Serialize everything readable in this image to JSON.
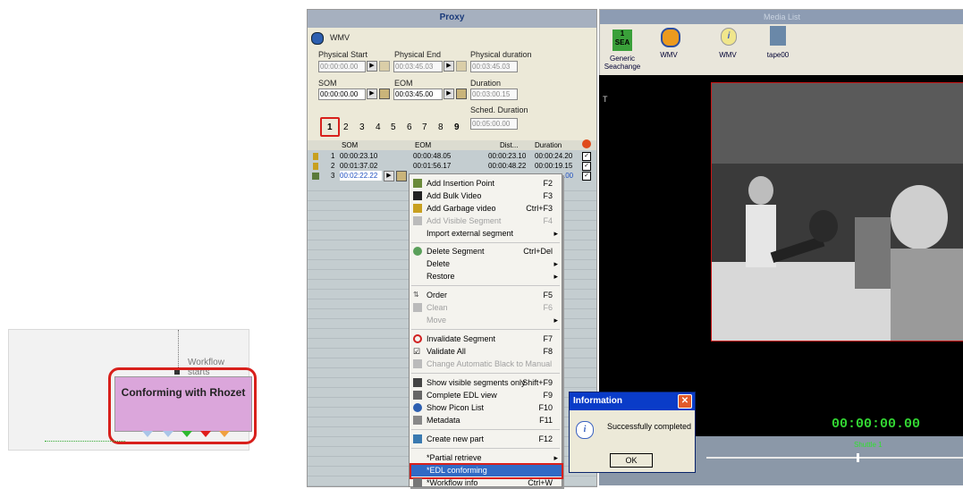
{
  "workflow": {
    "start_label": "Workflow starts",
    "node_label": "Conforming with Rhozet"
  },
  "proxy": {
    "title": "Proxy",
    "media_label": "WMV",
    "physical_start_label": "Physical Start",
    "physical_start_value": "00:00:00.00",
    "physical_end_label": "Physical End",
    "physical_end_value": "00:03:45.03",
    "physical_duration_label": "Physical duration",
    "physical_duration_value": "00:03:45.03",
    "som_label": "SOM",
    "som_value": "00:00:00.00",
    "eom_label": "EOM",
    "eom_value": "00:03:45.00",
    "duration_label": "Duration",
    "duration_value": "00:03:00.15",
    "sched_duration_label": "Sched. Duration",
    "sched_duration_value": "00:05:00.00",
    "parts": [
      "1",
      "2",
      "3",
      "4",
      "5",
      "6",
      "7",
      "8",
      "9"
    ]
  },
  "segments": {
    "columns": [
      "SOM",
      "EOM",
      "Dist...",
      "Duration"
    ],
    "rows": [
      {
        "num": "1",
        "som": "00:00:23.10",
        "eom": "00:00:48.05",
        "dist": "00:00:23.10",
        "duration": "00:00:24.20"
      },
      {
        "num": "2",
        "som": "00:01:37.02",
        "eom": "00:01:56.17",
        "dist": "00:00:48.22",
        "duration": "00:00:19.15"
      },
      {
        "num": "3",
        "som": "00:02:22.22",
        "eom": "",
        "dist": "",
        "duration": ".00"
      }
    ]
  },
  "context_menu": {
    "items": [
      {
        "label": "Add Insertion Point",
        "key": "F2"
      },
      {
        "label": "Add Bulk Video",
        "key": "F3"
      },
      {
        "label": "Add Garbage video",
        "key": "Ctrl+F3"
      },
      {
        "label": "Add Visible Segment",
        "key": "F4"
      },
      {
        "label": "Import external segment",
        "key": ""
      },
      {
        "label": "Delete Segment",
        "key": "Ctrl+Del"
      },
      {
        "label": "Delete",
        "key": ""
      },
      {
        "label": "Restore",
        "key": ""
      },
      {
        "label": "Order",
        "key": "F5"
      },
      {
        "label": "Clean",
        "key": "F6"
      },
      {
        "label": "Move",
        "key": ""
      },
      {
        "label": "Invalidate Segment",
        "key": "F7"
      },
      {
        "label": "Validate All",
        "key": "F8"
      },
      {
        "label": "Change Automatic Black to Manual",
        "key": ""
      },
      {
        "label": "Show visible segments only",
        "key": "Shift+F9"
      },
      {
        "label": "Complete EDL view",
        "key": "F9"
      },
      {
        "label": "Show Picon List",
        "key": "F10"
      },
      {
        "label": "Metadata",
        "key": "F11"
      },
      {
        "label": "Create new part",
        "key": "F12"
      },
      {
        "label": "*Partial retrieve",
        "key": ""
      },
      {
        "label": "*EDL conforming",
        "key": ""
      },
      {
        "label": "*Workflow info",
        "key": "Ctrl+W"
      }
    ]
  },
  "media_list": {
    "title": "Media List",
    "items": [
      {
        "badge": "1\nSEA",
        "label": "Generic Seachange"
      },
      {
        "badge": "",
        "label": "WMV"
      },
      {
        "badge": "",
        "label": "WMV"
      },
      {
        "badge": "",
        "label": "tape00"
      }
    ]
  },
  "player": {
    "side_label": "T",
    "timecode": "00:00:00.00",
    "shuttle_label": "Shuttle 1"
  },
  "info_dialog": {
    "title": "Information",
    "message": "Successfully completed",
    "ok_label": "OK"
  }
}
